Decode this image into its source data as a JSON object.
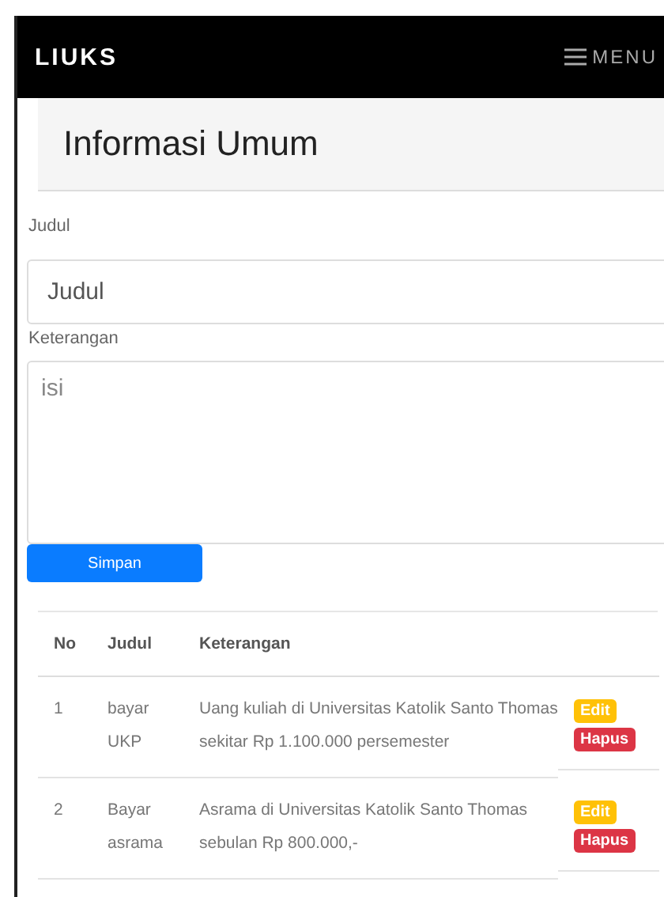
{
  "navbar": {
    "brand": "LIUKS",
    "menu": "MENU"
  },
  "header": {
    "title": "Informasi Umum"
  },
  "form": {
    "fields": [
      {
        "label": "Judul",
        "kind": "input",
        "placeholder": "Judul"
      },
      {
        "label": "Keterangan",
        "kind": "textarea",
        "placeholder": "isi"
      }
    ],
    "submit": "Simpan"
  },
  "table": {
    "columns": [
      "No",
      "Judul",
      "Keterangan"
    ],
    "rows": [
      {
        "no": "1",
        "judul": "bayar UKP",
        "keterangan": "Uang kuliah di Universitas Katolik Santo Thomas sekitar Rp 1.100.000 persemester",
        "actions": [
          "Edit",
          "Hapus"
        ]
      },
      {
        "no": "2",
        "judul": "Bayar asrama",
        "keterangan": "Asrama di Universitas Katolik Santo Thomas sebulan Rp 800.000,-",
        "actions": [
          "Edit",
          "Hapus"
        ]
      }
    ]
  }
}
